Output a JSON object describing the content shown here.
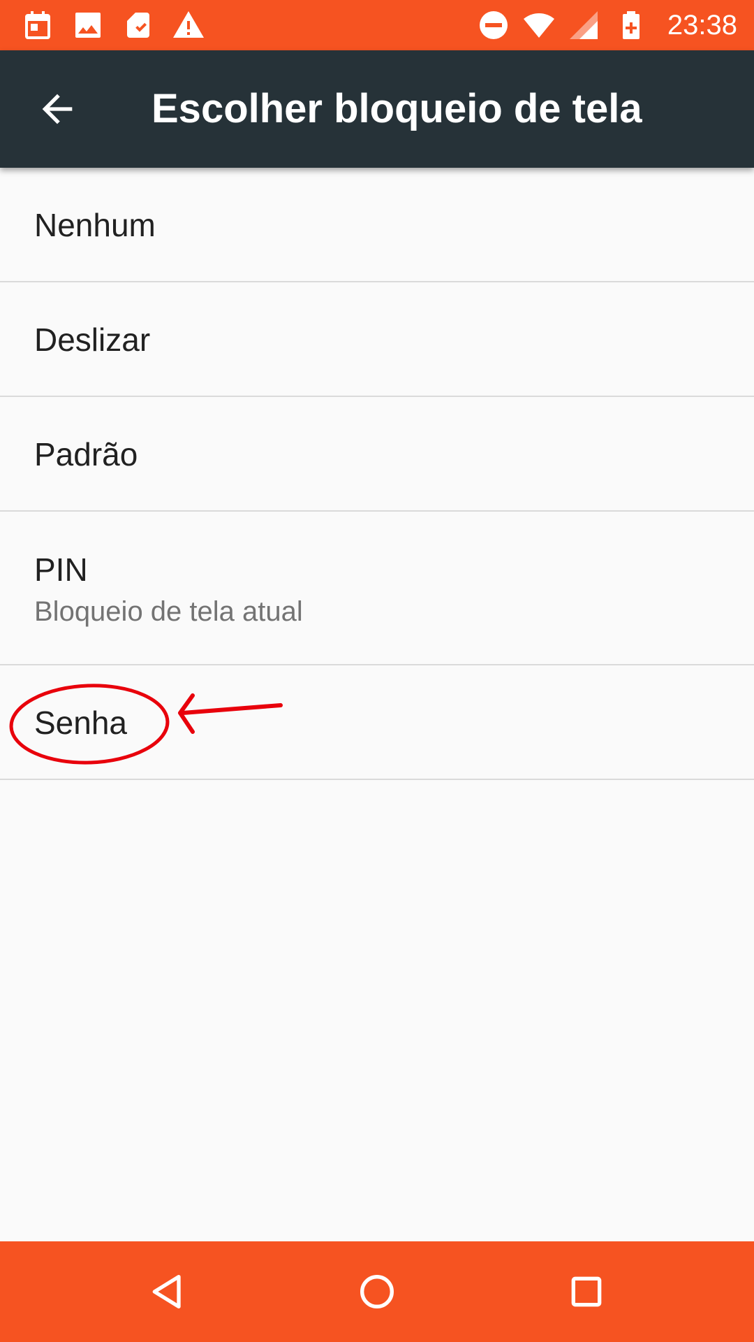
{
  "status_bar": {
    "left_icons": [
      "calendar-icon",
      "image-icon",
      "sd-card-icon",
      "warning-icon"
    ],
    "right_icons": [
      "do-not-disturb-icon",
      "wifi-icon",
      "cell-signal-icon",
      "battery-charging-icon"
    ],
    "time": "23:38",
    "background_color": "#f65321"
  },
  "app_bar": {
    "back_icon": "arrow-back-icon",
    "title": "Escolher bloqueio de tela",
    "background_color": "#263238"
  },
  "options": [
    {
      "title": "Nenhum"
    },
    {
      "title": "Deslizar"
    },
    {
      "title": "Padrão"
    },
    {
      "title": "PIN",
      "subtitle": "Bloqueio de tela atual"
    },
    {
      "title": "Senha"
    }
  ],
  "annotation": {
    "type": "hand-drawn-circle-and-arrow",
    "target": "Senha",
    "color": "#e8000b"
  },
  "nav_bar": {
    "buttons": [
      "back-triangle-icon",
      "home-circle-icon",
      "recents-square-icon"
    ],
    "background_color": "#f65321"
  }
}
